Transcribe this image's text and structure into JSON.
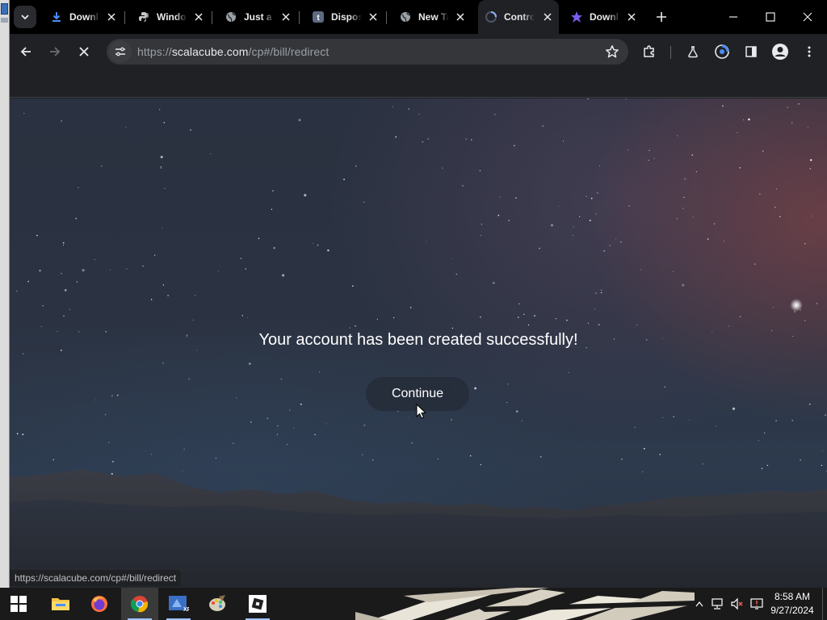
{
  "tabs": [
    {
      "title": "Downl",
      "icon": "download-icon"
    },
    {
      "title": "Windo",
      "icon": "python-icon"
    },
    {
      "title": "Just a",
      "icon": "globe-icon"
    },
    {
      "title": "Dispos",
      "icon": "tumblr-icon"
    },
    {
      "title": "New Ta",
      "icon": "globe-icon"
    },
    {
      "title": "Contro",
      "icon": "spinner-icon",
      "active": true
    },
    {
      "title": "Downl",
      "icon": "star-logo-icon"
    }
  ],
  "toolbar": {
    "url_scheme": "https://",
    "url_host": "scalacube.com",
    "url_path": "/cp#/bill/redirect"
  },
  "page": {
    "message": "Your account has been created successfully!",
    "continue_label": "Continue"
  },
  "status_bar": {
    "url": "https://scalacube.com/cp#/bill/redirect"
  },
  "taskbar": {
    "apps": [
      "start-icon",
      "file-explorer-icon",
      "firefox-icon",
      "chrome-icon",
      "xp-app-icon",
      "paint-icon",
      "roblox-icon"
    ],
    "time": "8:58 AM",
    "date": "9/27/2024"
  },
  "colors": {
    "tab_strip": "#000000",
    "toolbar": "#202124",
    "omnibox": "#35363a",
    "text_primary": "#e8eaed",
    "accent_taskbar": "#9ec3ff"
  }
}
